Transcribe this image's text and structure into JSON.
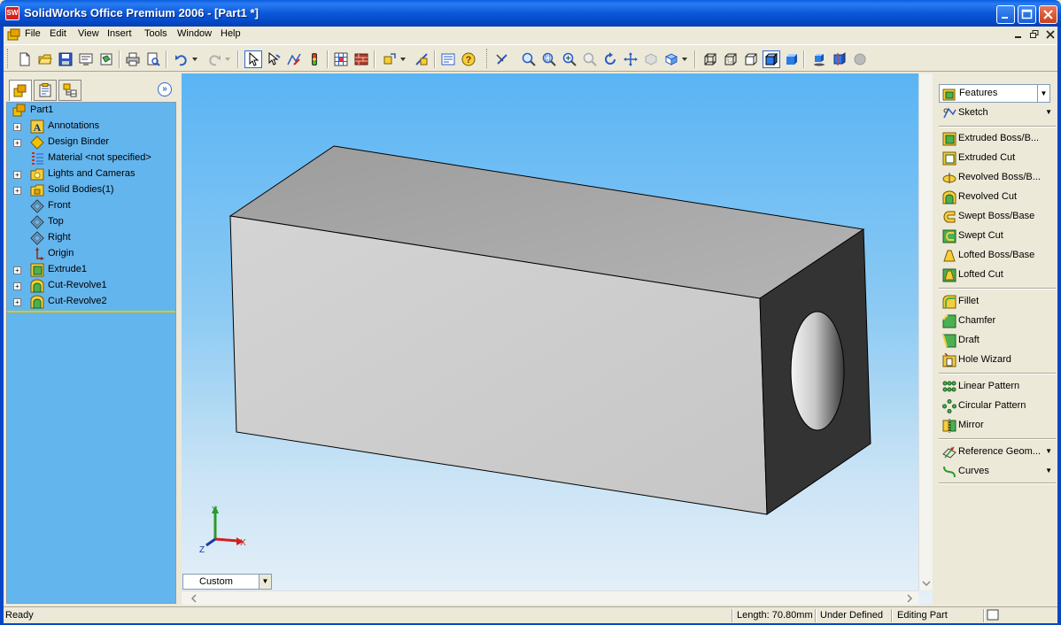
{
  "window": {
    "title": "SolidWorks Office Premium 2006 - [Part1 *]",
    "app_icon_text": "SW"
  },
  "menu": {
    "items": [
      "File",
      "Edit",
      "View",
      "Insert",
      "Tools",
      "Window",
      "Help"
    ]
  },
  "feature_tree": {
    "items": [
      {
        "label": "Part1",
        "icon": "part-icon",
        "expandable": false
      },
      {
        "label": "Annotations",
        "icon": "annotations-icon",
        "expandable": true
      },
      {
        "label": "Design Binder",
        "icon": "design-binder-icon",
        "expandable": true
      },
      {
        "label": "Material <not specified>",
        "icon": "material-icon",
        "expandable": false
      },
      {
        "label": "Lights and Cameras",
        "icon": "lights-icon",
        "expandable": true
      },
      {
        "label": "Solid Bodies(1)",
        "icon": "solid-bodies-icon",
        "expandable": true
      },
      {
        "label": "Front",
        "icon": "plane-icon",
        "expandable": false
      },
      {
        "label": "Top",
        "icon": "plane-icon",
        "expandable": false
      },
      {
        "label": "Right",
        "icon": "plane-icon",
        "expandable": false
      },
      {
        "label": "Origin",
        "icon": "origin-icon",
        "expandable": false
      },
      {
        "label": "Extrude1",
        "icon": "extrude-icon",
        "expandable": true
      },
      {
        "label": "Cut-Revolve1",
        "icon": "revolve-cut-icon",
        "expandable": true
      },
      {
        "label": "Cut-Revolve2",
        "icon": "revolve-cut-icon",
        "expandable": true
      }
    ]
  },
  "view_orientation": "Custom",
  "triad": {
    "x": "X",
    "y": "Y",
    "z": "Z"
  },
  "command_manager": {
    "dropdown": "Features",
    "sketch": "Sketch",
    "groups": [
      [
        {
          "label": "Extruded Boss/B...",
          "icon": "extruded-boss-icon"
        },
        {
          "label": "Extruded Cut",
          "icon": "extruded-cut-icon"
        },
        {
          "label": "Revolved Boss/B...",
          "icon": "revolved-boss-icon"
        },
        {
          "label": "Revolved Cut",
          "icon": "revolved-cut-icon"
        },
        {
          "label": "Swept Boss/Base",
          "icon": "swept-boss-icon"
        },
        {
          "label": "Swept Cut",
          "icon": "swept-cut-icon"
        },
        {
          "label": "Lofted Boss/Base",
          "icon": "lofted-boss-icon"
        },
        {
          "label": "Lofted Cut",
          "icon": "lofted-cut-icon"
        }
      ],
      [
        {
          "label": "Fillet",
          "icon": "fillet-icon"
        },
        {
          "label": "Chamfer",
          "icon": "chamfer-icon"
        },
        {
          "label": "Draft",
          "icon": "draft-icon"
        },
        {
          "label": "Hole Wizard",
          "icon": "hole-wizard-icon"
        }
      ],
      [
        {
          "label": "Linear Pattern",
          "icon": "linear-pattern-icon"
        },
        {
          "label": "Circular Pattern",
          "icon": "circular-pattern-icon"
        },
        {
          "label": "Mirror",
          "icon": "mirror-icon"
        }
      ],
      [
        {
          "label": "Reference Geom...",
          "icon": "reference-geometry-icon"
        },
        {
          "label": "Curves",
          "icon": "curves-icon"
        }
      ]
    ]
  },
  "status": {
    "left": "Ready",
    "length": "Length: 70.80mm",
    "definition": "Under Defined",
    "mode": "Editing Part"
  },
  "colors": {
    "viewport_top": "#5ab4f4",
    "viewport_bottom": "#e6f0f8",
    "tree_background": "#63b5ee",
    "part_top": "#a4a4a4",
    "part_front": "#d0d0d0",
    "part_end": "#333333"
  }
}
